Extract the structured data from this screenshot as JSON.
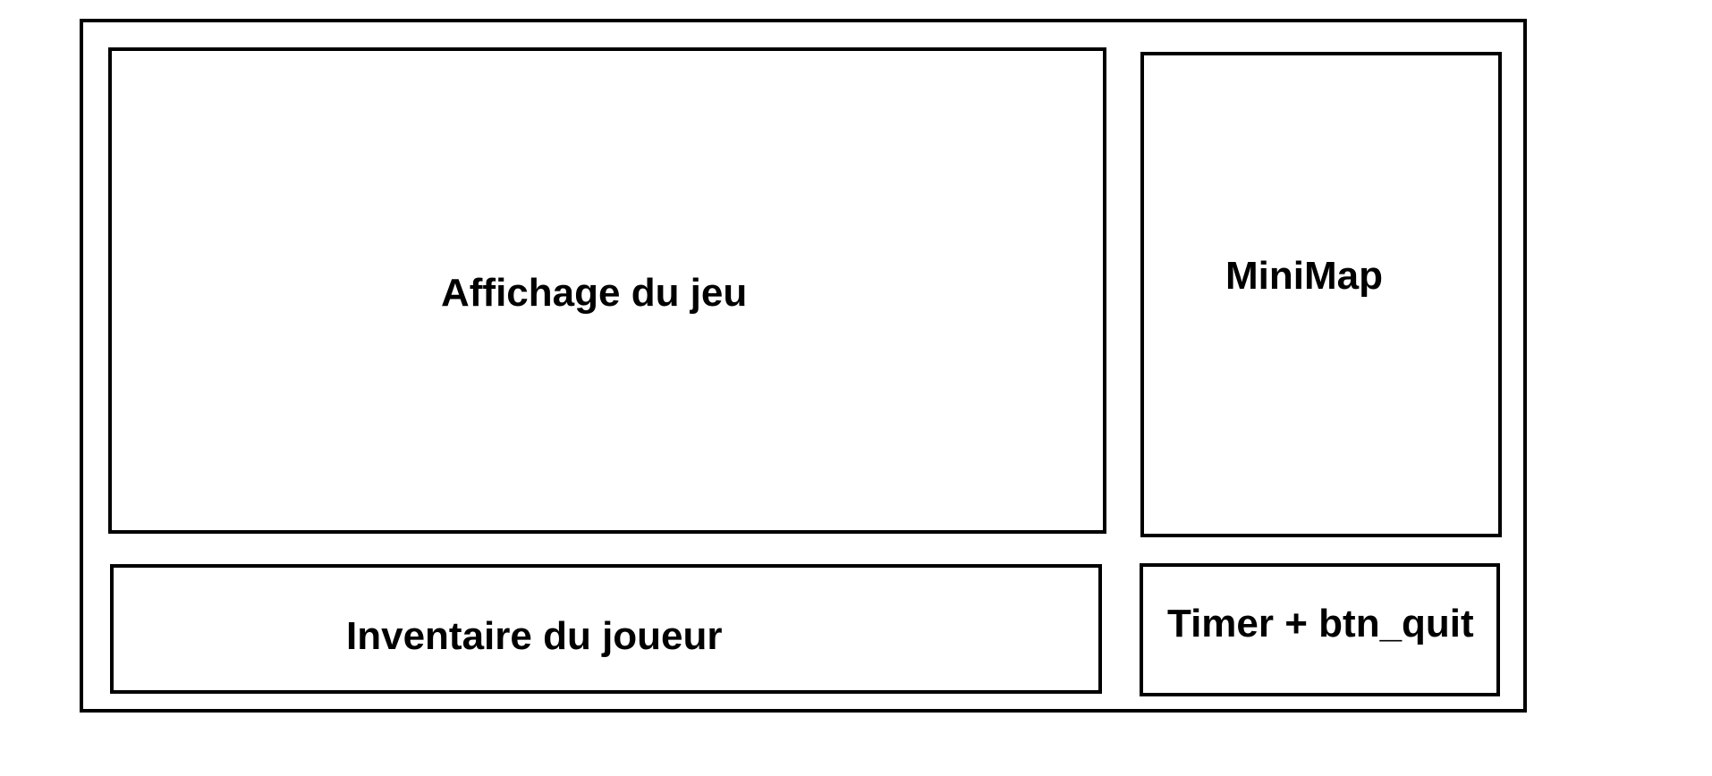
{
  "layout": {
    "game_view": {
      "label": "Affichage du jeu"
    },
    "minimap": {
      "label": "MiniMap"
    },
    "inventory": {
      "label": "Inventaire du joueur"
    },
    "timer_quit": {
      "label": "Timer + btn_quit"
    }
  },
  "colors": {
    "stroke": "#000000",
    "background": "#ffffff"
  }
}
